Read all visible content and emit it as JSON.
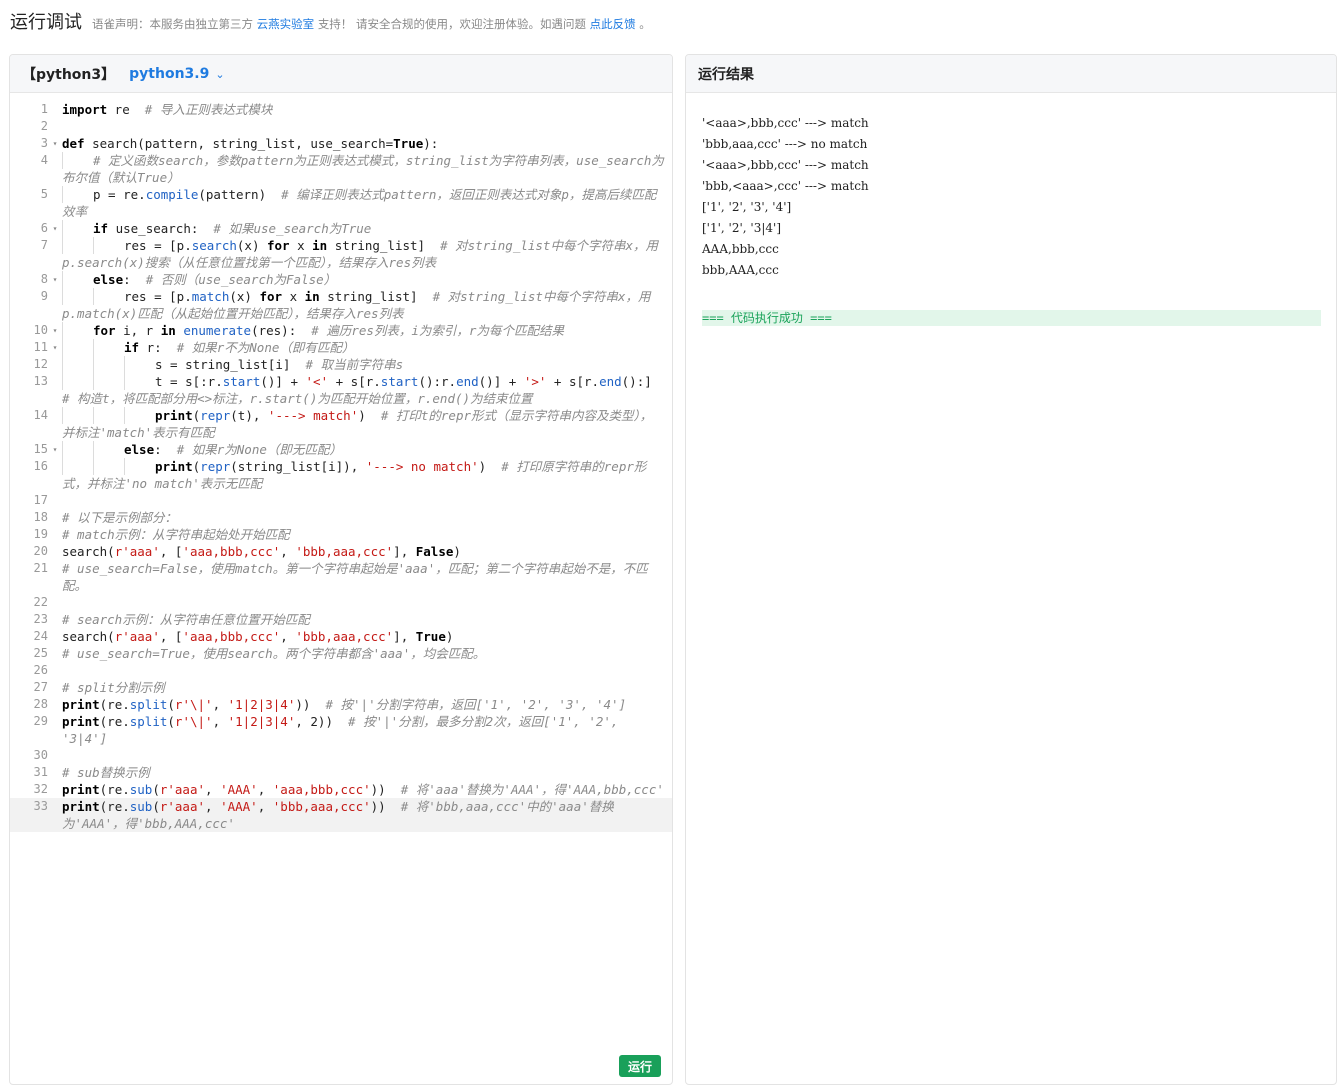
{
  "header": {
    "title": "运行调试",
    "notice_prefix": "语雀声明：本服务由独立第三方",
    "notice_link1": "云燕实验室",
    "notice_middle": "支持！ 请安全合规的使用，欢迎注册体验。如遇问题",
    "notice_link2": "点此反馈",
    "notice_suffix": "。"
  },
  "editor": {
    "lang_label": "【python3】",
    "version_label": "python3.9",
    "run_label": "运行"
  },
  "result": {
    "title": "运行结果",
    "lines": [
      "'<aaa>,bbb,ccc' ---> match",
      "'bbb,aaa,ccc' ---> no match",
      "'<aaa>,bbb,ccc' ---> match",
      "'bbb,<aaa>,ccc' ---> match",
      "['1', '2', '3', '4']",
      "['1', '2', '3|4']",
      "AAA,bbb,ccc",
      "bbb,AAA,ccc"
    ],
    "status": "=== 代码执行成功 ==="
  },
  "code_lines": [
    {
      "n": "1",
      "fold": false
    },
    {
      "n": "2",
      "fold": false
    },
    {
      "n": "3",
      "fold": true
    },
    {
      "n": "4",
      "fold": false
    },
    {
      "n": "5",
      "fold": false
    },
    {
      "n": "6",
      "fold": true
    },
    {
      "n": "7",
      "fold": false
    },
    {
      "n": "8",
      "fold": true
    },
    {
      "n": "9",
      "fold": false
    },
    {
      "n": "10",
      "fold": true
    },
    {
      "n": "11",
      "fold": true
    },
    {
      "n": "12",
      "fold": false
    },
    {
      "n": "13",
      "fold": false
    },
    {
      "n": "14",
      "fold": false
    },
    {
      "n": "15",
      "fold": true
    },
    {
      "n": "16",
      "fold": false
    },
    {
      "n": "17",
      "fold": false
    },
    {
      "n": "18",
      "fold": false
    },
    {
      "n": "19",
      "fold": false
    },
    {
      "n": "20",
      "fold": false
    },
    {
      "n": "21",
      "fold": false
    },
    {
      "n": "22",
      "fold": false
    },
    {
      "n": "23",
      "fold": false
    },
    {
      "n": "24",
      "fold": false
    },
    {
      "n": "25",
      "fold": false
    },
    {
      "n": "26",
      "fold": false
    },
    {
      "n": "27",
      "fold": false
    },
    {
      "n": "28",
      "fold": false
    },
    {
      "n": "29",
      "fold": false
    },
    {
      "n": "30",
      "fold": false
    },
    {
      "n": "31",
      "fold": false
    },
    {
      "n": "32",
      "fold": false
    },
    {
      "n": "33",
      "fold": false
    }
  ],
  "code_html": [
    "<span class=\"kw\">import</span> re  <span class=\"cm\"># 导入正则表达式模块</span>",
    "",
    "<span class=\"kw\">def</span> search(pattern, string_list, use_search=<span class=\"kw\">True</span>):",
    "<span class=\"ind\"></span><span class=\"cm\"># 定义函数search，参数pattern为正则表达式模式，string_list为字符串列表，use_search为布尔值（默认True）</span>",
    "<span class=\"ind\"></span>p = re.<span class=\"fn\">compile</span>(pattern)  <span class=\"cm\"># 编译正则表达式pattern，返回正则表达式对象p，提高后续匹配效率</span>",
    "<span class=\"ind\"></span><span class=\"kw\">if</span> use_search:  <span class=\"cm\"># 如果use_search为True</span>",
    "<span class=\"ind\"></span><span class=\"ind\"></span>res = [p.<span class=\"fn\">search</span>(x) <span class=\"kw\">for</span> x <span class=\"kw\">in</span> string_list]  <span class=\"cm\"># 对string_list中每个字符串x，用p.search(x)搜索（从任意位置找第一个匹配），结果存入res列表</span>",
    "<span class=\"ind\"></span><span class=\"kw\">else</span>:  <span class=\"cm\"># 否则（use_search为False）</span>",
    "<span class=\"ind\"></span><span class=\"ind\"></span>res = [p.<span class=\"fn\">match</span>(x) <span class=\"kw\">for</span> x <span class=\"kw\">in</span> string_list]  <span class=\"cm\"># 对string_list中每个字符串x，用p.match(x)匹配（从起始位置开始匹配），结果存入res列表</span>",
    "<span class=\"ind\"></span><span class=\"kw\">for</span> i, r <span class=\"kw\">in</span> <span class=\"fn\">enumerate</span>(res):  <span class=\"cm\"># 遍历res列表，i为索引，r为每个匹配结果</span>",
    "<span class=\"ind\"></span><span class=\"ind\"></span><span class=\"kw\">if</span> r:  <span class=\"cm\"># 如果r不为None（即有匹配）</span>",
    "<span class=\"ind\"></span><span class=\"ind\"></span><span class=\"ind\"></span>s = string_list[i]  <span class=\"cm\"># 取当前字符串s</span>",
    "<span class=\"ind\"></span><span class=\"ind\"></span><span class=\"ind\"></span>t = s[:r.<span class=\"fn\">start</span>()] + <span class=\"st\">'&lt;'</span> + s[r.<span class=\"fn\">start</span>():r.<span class=\"fn\">end</span>()] + <span class=\"st\">'&gt;'</span> + s[r.<span class=\"fn\">end</span>():]  <span class=\"cm\"># 构造t，将匹配部分用&lt;&gt;标注，r.start()为匹配开始位置，r.end()为结束位置</span>",
    "<span class=\"ind\"></span><span class=\"ind\"></span><span class=\"ind\"></span><span class=\"kw\">print</span>(<span class=\"fn\">repr</span>(t), <span class=\"st\">'---&gt; match'</span>)  <span class=\"cm\"># 打印t的repr形式（显示字符串内容及类型），并标注'match'表示有匹配</span>",
    "<span class=\"ind\"></span><span class=\"ind\"></span><span class=\"kw\">else</span>:  <span class=\"cm\"># 如果r为None（即无匹配）</span>",
    "<span class=\"ind\"></span><span class=\"ind\"></span><span class=\"ind\"></span><span class=\"kw\">print</span>(<span class=\"fn\">repr</span>(string_list[i]), <span class=\"st\">'---&gt; no match'</span>)  <span class=\"cm\"># 打印原字符串的repr形式，并标注'no match'表示无匹配</span>",
    "",
    "<span class=\"cm\"># 以下是示例部分：</span>",
    "<span class=\"cm\"># match示例：从字符串起始处开始匹配</span>",
    "search(<span class=\"st\">r'aaa'</span>, [<span class=\"st\">'aaa,bbb,ccc'</span>, <span class=\"st\">'bbb,aaa,ccc'</span>], <span class=\"kw\">False</span>)",
    "<span class=\"cm\"># use_search=False，使用match。第一个字符串起始是'aaa'，匹配；第二个字符串起始不是，不匹配。</span>",
    "",
    "<span class=\"cm\"># search示例：从字符串任意位置开始匹配</span>",
    "search(<span class=\"st\">r'aaa'</span>, [<span class=\"st\">'aaa,bbb,ccc'</span>, <span class=\"st\">'bbb,aaa,ccc'</span>], <span class=\"kw\">True</span>)",
    "<span class=\"cm\"># use_search=True，使用search。两个字符串都含'aaa'，均会匹配。</span>",
    "",
    "<span class=\"cm\"># split分割示例</span>",
    "<span class=\"kw\">print</span>(re.<span class=\"fn\">split</span>(<span class=\"st\">r'\\|'</span>, <span class=\"st\">'1|2|3|4'</span>))  <span class=\"cm\"># 按'|'分割字符串，返回['1', '2', '3', '4']</span>",
    "<span class=\"kw\">print</span>(re.<span class=\"fn\">split</span>(<span class=\"st\">r'\\|'</span>, <span class=\"st\">'1|2|3|4'</span>, 2))  <span class=\"cm\"># 按'|'分割，最多分割2次，返回['1', '2', '3|4']</span>",
    "",
    "<span class=\"cm\"># sub替换示例</span>",
    "<span class=\"kw\">print</span>(re.<span class=\"fn\">sub</span>(<span class=\"st\">r'aaa'</span>, <span class=\"st\">'AAA'</span>, <span class=\"st\">'aaa,bbb,ccc'</span>))  <span class=\"cm\"># 将'aaa'替换为'AAA'，得'AAA,bbb,ccc'</span>",
    "<span class=\"kw\">print</span>(re.<span class=\"fn\">sub</span>(<span class=\"st\">r'aaa'</span>, <span class=\"st\">'AAA'</span>, <span class=\"st\">'bbb,aaa,ccc'</span>))  <span class=\"cm\"># 将'bbb,aaa,ccc'中的'aaa'替换为'AAA'，得'bbb,AAA,ccc'</span>"
  ]
}
